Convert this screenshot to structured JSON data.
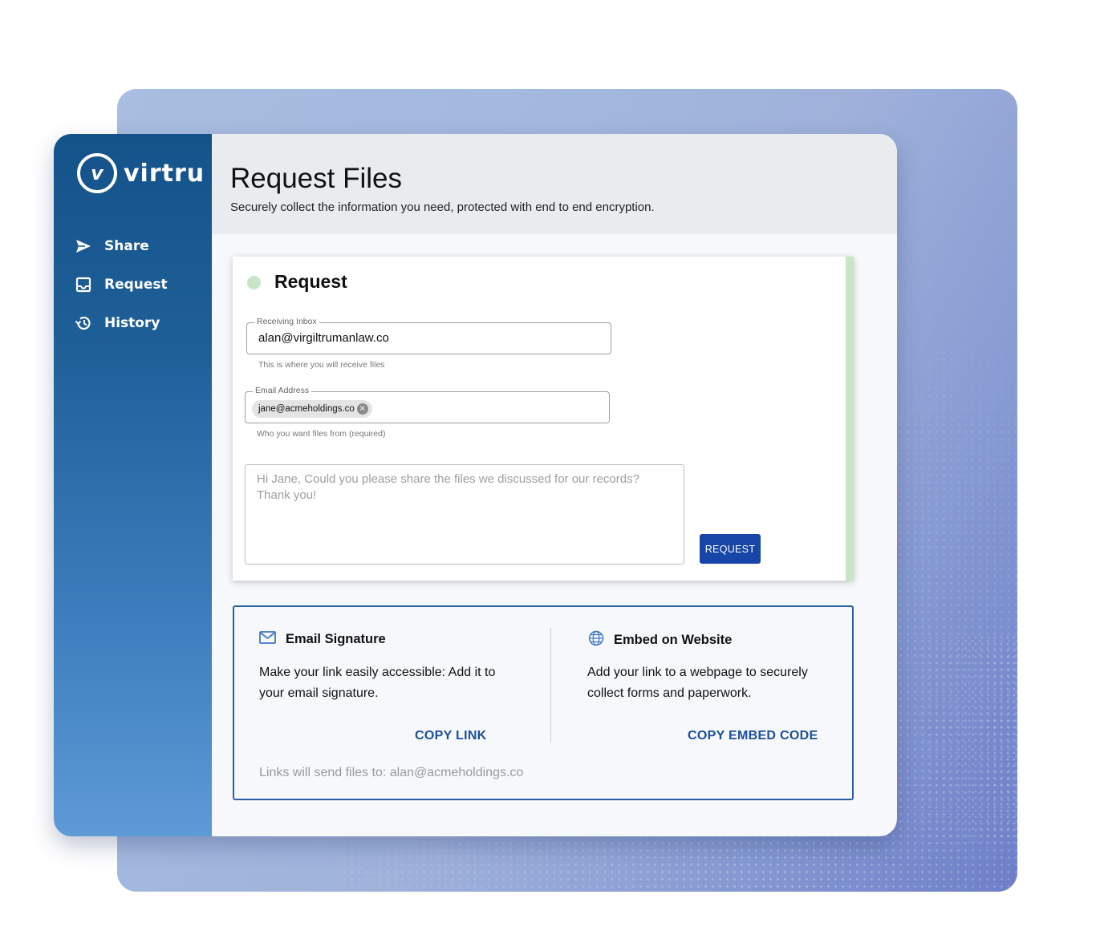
{
  "brand": {
    "logo_mark": "v",
    "name": "virtru"
  },
  "sidebar": {
    "items": [
      {
        "label": "Share",
        "icon": "send-icon"
      },
      {
        "label": "Request",
        "icon": "inbox-icon"
      },
      {
        "label": "History",
        "icon": "history-icon"
      }
    ]
  },
  "header": {
    "title": "Request Files",
    "subtitle": "Securely collect the information you need, protected with end to end encryption."
  },
  "request_card": {
    "title": "Request",
    "receiving_inbox": {
      "legend": "Receiving Inbox",
      "value": "alan@virgiltrumanlaw.co",
      "helper": "This is where you will receive files"
    },
    "email_address": {
      "legend": "Email Address",
      "chip": "jane@acmeholdings.co",
      "chip_remove": "×",
      "helper": "Who you want files from (required)"
    },
    "message": "Hi Jane, Could you please share the files we discussed for our records? Thank you!",
    "button": "REQUEST"
  },
  "links_card": {
    "email_signature": {
      "title": "Email Signature",
      "icon": "mail-icon",
      "description": "Make your link easily accessible: Add it to your email signature.",
      "action": "COPY LINK"
    },
    "embed_website": {
      "title": "Embed on Website",
      "icon": "globe-icon",
      "description": "Add your link to a webpage to securely collect forms and paperwork.",
      "action": "COPY EMBED CODE"
    },
    "note": "Links will send files to: alan@acmeholdings.co"
  },
  "colors": {
    "sidebar_top": "#14528a",
    "sidebar_bottom": "#5e9ad6",
    "accent_button": "#1845a8",
    "status_green": "#c8e6c6",
    "link_blue": "#1c4f9c"
  }
}
